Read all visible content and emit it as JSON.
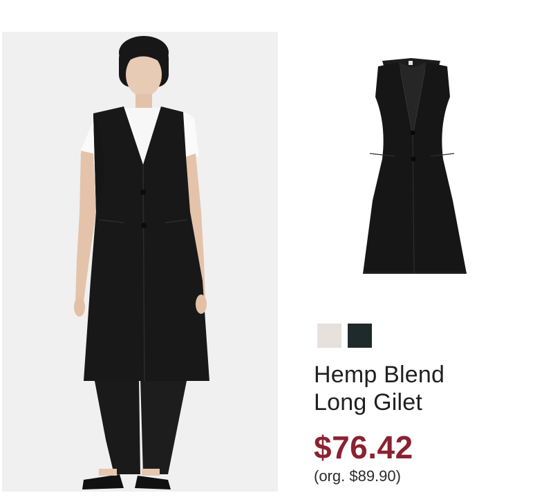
{
  "product": {
    "name_line1": "Hemp Blend",
    "name_line2": "Long Gilet",
    "price": "$76.42",
    "original_price": "(org. $89.90)",
    "price_color": "#8a2231"
  },
  "swatches": [
    {
      "color": "#e6e1dc"
    },
    {
      "color": "#1f2b2b"
    }
  ],
  "images": {
    "model_photo_icon": "model-photo",
    "product_photo_icon": "gilet-product-photo"
  }
}
